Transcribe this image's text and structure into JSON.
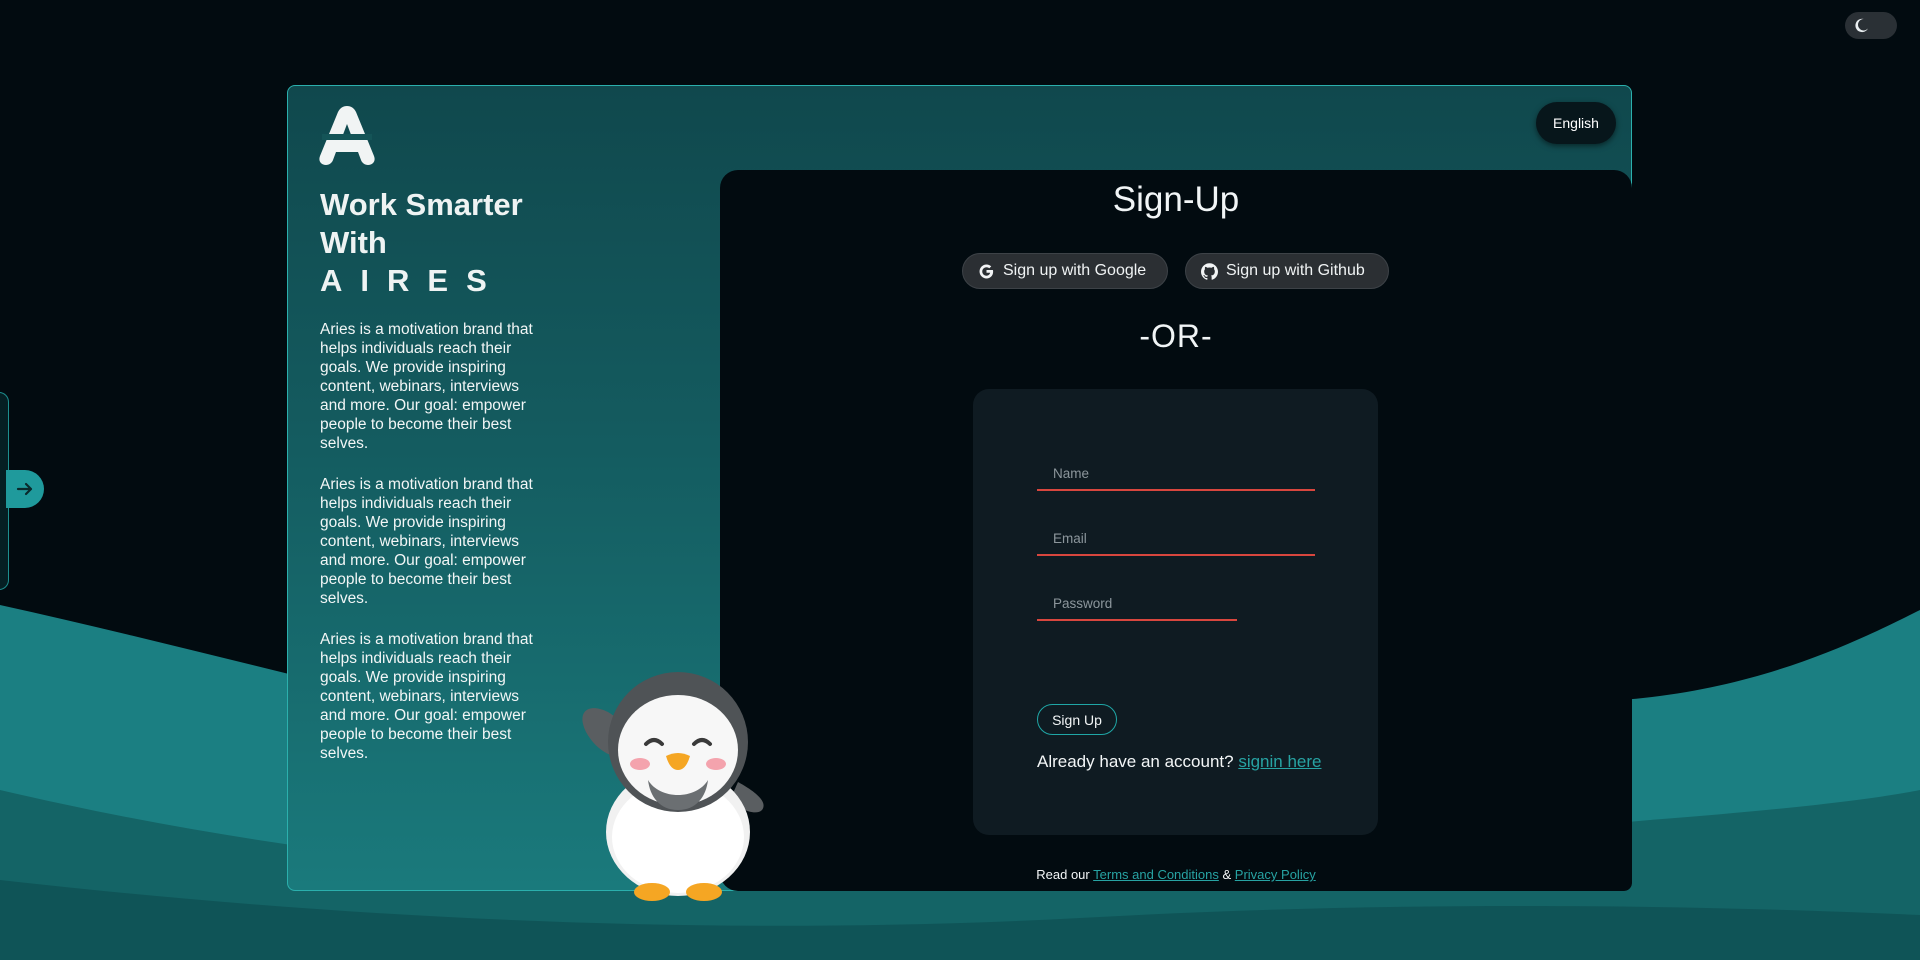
{
  "theme_toggle": {
    "icon": "moon-icon"
  },
  "side_nav": {
    "icon": "arrow-right-icon"
  },
  "brand": {
    "logo_letter": "A",
    "logo_icon": "aires-logo-icon"
  },
  "left": {
    "headline_line1": "Work Smarter",
    "headline_line2": "With",
    "headline_brand": "AIRES",
    "paragraphs": [
      "Aries is a motivation brand that helps individuals reach their goals. We provide inspiring content, webinars, interviews and more. Our goal: empower people to become their best selves.",
      "Aries is a motivation brand that helps individuals reach their goals. We provide inspiring content, webinars, interviews and more. Our goal: empower people to become their best selves.",
      "Aries is a motivation brand that helps individuals reach their goals. We provide inspiring content, webinars, interviews and more. Our goal: empower people to become their best selves."
    ]
  },
  "language": {
    "label": "English"
  },
  "form": {
    "title": "Sign-Up",
    "google_label": "Sign up with Google",
    "github_label": "Sign up with Github",
    "or_text": "-OR-",
    "name_placeholder": "Name",
    "email_placeholder": "Email",
    "password_placeholder": "Password",
    "submit_label": "Sign Up",
    "already_text": "Already have an account?",
    "signin_link": "signin here"
  },
  "legal": {
    "prefix": "Read our",
    "terms": "Terms and Conditions",
    "amp": "&",
    "privacy": "Privacy Policy"
  },
  "colors": {
    "background": "#020b10",
    "teal": "#1f9a9c",
    "card_teal": "#145c60",
    "field_underline": "#d8463e",
    "link": "#27a3a3"
  }
}
